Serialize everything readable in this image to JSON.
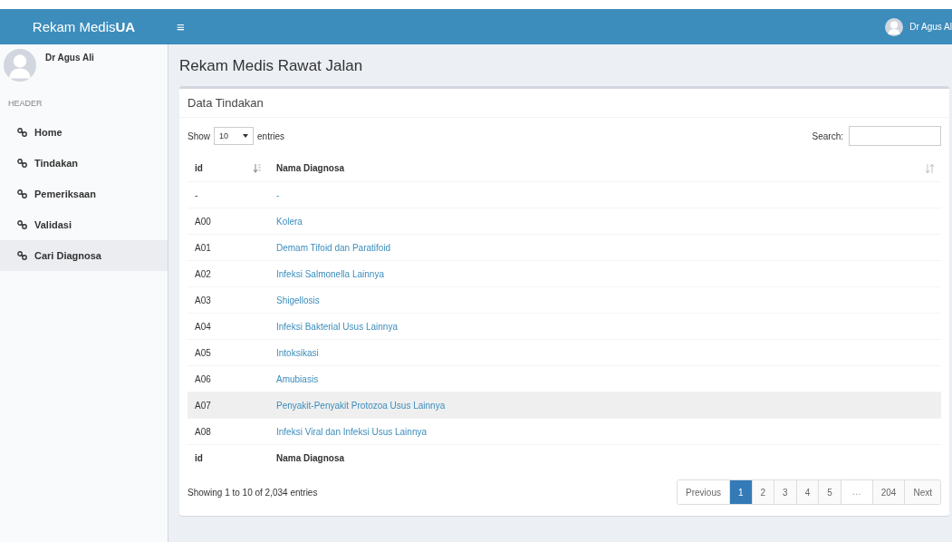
{
  "header": {
    "logo_regular": "Rekam Medis",
    "logo_bold": "UA",
    "menu_toggle": "≡",
    "user_name": "Dr Agus Al"
  },
  "sidebar": {
    "user_name": "Dr Agus Ali",
    "section_label": "HEADER",
    "items": [
      {
        "label": "Home",
        "selected": false
      },
      {
        "label": "Tindakan",
        "selected": false
      },
      {
        "label": "Pemeriksaan",
        "selected": false
      },
      {
        "label": "Validasi",
        "selected": false
      },
      {
        "label": "Cari Diagnosa",
        "selected": true
      }
    ]
  },
  "page_title": "Rekam Medis Rawat Jalan",
  "card": {
    "title": "Data Tindakan",
    "show_label": "Show",
    "entries_select": "10",
    "entries_label": "entries",
    "search_label": "Search:",
    "table": {
      "columns": [
        "id",
        "Nama Diagnosa"
      ],
      "rows": [
        {
          "id": "-",
          "name": "-",
          "highlighted": false
        },
        {
          "id": "A00",
          "name": "Kolera",
          "highlighted": false
        },
        {
          "id": "A01",
          "name": "Demam Tifoid dan Paratifoid",
          "highlighted": false
        },
        {
          "id": "A02",
          "name": "Infeksi Salmonella Lainnya",
          "highlighted": false
        },
        {
          "id": "A03",
          "name": "Shigellosis",
          "highlighted": false
        },
        {
          "id": "A04",
          "name": "Infeksi Bakterial Usus Lainnya",
          "highlighted": false
        },
        {
          "id": "A05",
          "name": "Intoksikasi",
          "highlighted": false
        },
        {
          "id": "A06",
          "name": "Amubiasis",
          "highlighted": false
        },
        {
          "id": "A07",
          "name": "Penyakit-Penyakit Protozoa Usus Lainnya",
          "highlighted": true
        },
        {
          "id": "A08",
          "name": "Infeksi Viral dan Infeksi Usus Lainnya",
          "highlighted": false
        }
      ],
      "footer_columns": [
        "id",
        "Nama Diagnosa"
      ]
    },
    "info": "Showing 1 to 10 of 2,034 entries",
    "pagination": [
      {
        "label": "Previous",
        "kind": "nav",
        "selected": false
      },
      {
        "label": "1",
        "kind": "page",
        "selected": true
      },
      {
        "label": "2",
        "kind": "page",
        "selected": false
      },
      {
        "label": "3",
        "kind": "page",
        "selected": false
      },
      {
        "label": "4",
        "kind": "page",
        "selected": false
      },
      {
        "label": "5",
        "kind": "page",
        "selected": false
      },
      {
        "label": "…",
        "kind": "ellipsis",
        "selected": false
      },
      {
        "label": "204",
        "kind": "page",
        "selected": false
      },
      {
        "label": "Next",
        "kind": "nav",
        "selected": false
      }
    ]
  }
}
